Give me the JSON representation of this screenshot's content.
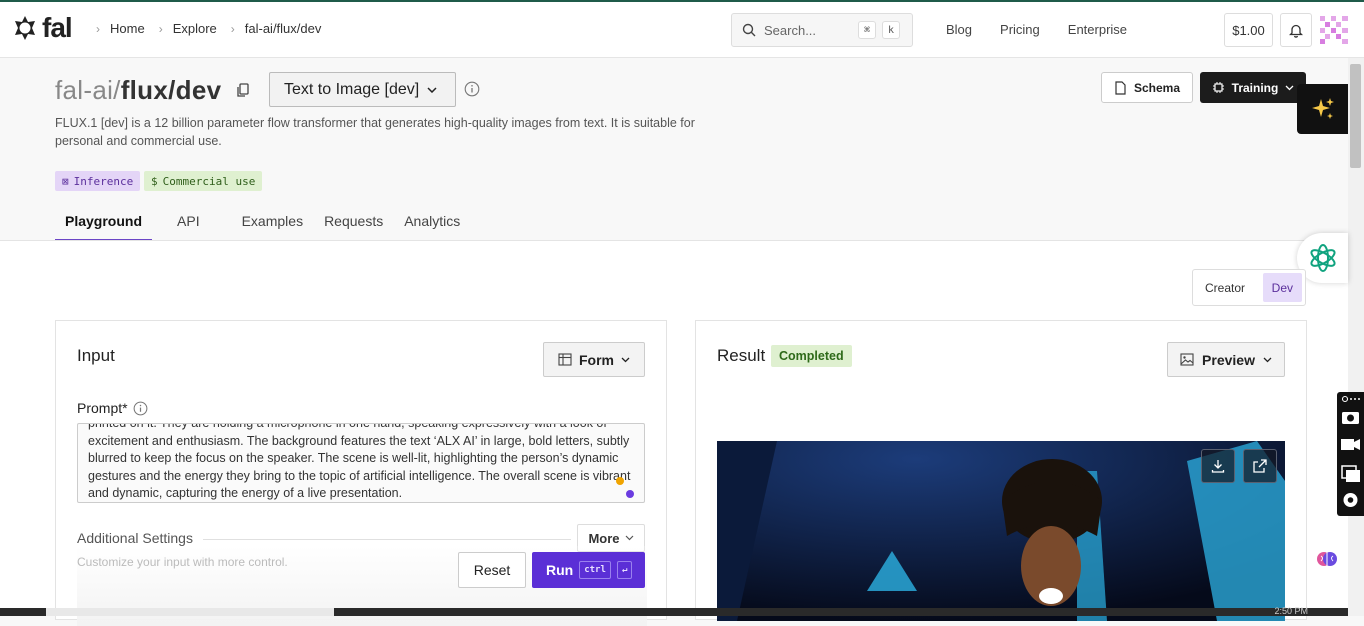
{
  "nav": {
    "logo_text": "fal",
    "breadcrumb": [
      "Home",
      "Explore",
      "fal-ai/flux/dev"
    ],
    "search_placeholder": "Search...",
    "search_keys": [
      "⌘",
      "k"
    ],
    "links": [
      "Blog",
      "Pricing",
      "Enterprise"
    ],
    "balance": "$1.00"
  },
  "header": {
    "title_prefix": "fal-ai/",
    "title_main": "flux/dev",
    "model_type": "Text to Image [dev]",
    "description": "FLUX.1 [dev] is a 12 billion parameter flow transformer that generates high-quality images from text. It is suitable for personal and commercial use.",
    "badges": [
      "Inference",
      "Commercial use"
    ],
    "schema_label": "Schema",
    "training_label": "Training"
  },
  "tabs": [
    "Playground",
    "API",
    "Examples",
    "Requests",
    "Analytics"
  ],
  "active_tab": "Playground",
  "mode": {
    "options": [
      "Creator",
      "Dev"
    ],
    "selected": "Dev"
  },
  "input": {
    "title": "Input",
    "form_label": "Form",
    "prompt_label": "Prompt*",
    "prompt_text": "printed on it. They are holding a microphone in one hand, speaking expressively with a look of excitement and enthusiasm. The background features the text ‘ALX AI’ in large, bold letters, subtly blurred to keep the focus on the speaker. The scene is well-lit, highlighting the person’s dynamic gestures and the energy they bring to the topic of artificial intelligence. The overall scene is vibrant and dynamic, capturing the energy of a live presentation.",
    "additional_settings": "Additional Settings",
    "more_label": "More",
    "additional_sub": "Customize your input with more control.",
    "reset_label": "Reset",
    "run_label": "Run",
    "run_kbd": [
      "ctrl",
      "↵"
    ]
  },
  "result": {
    "title": "Result",
    "status": "Completed",
    "preview_label": "Preview"
  },
  "taskbar": {
    "time": "2:50 PM"
  },
  "colors": {
    "accent": "#5b2fd6",
    "tab_underline": "#6b45c6",
    "status_bg": "#dff0d0",
    "inference_bg": "#e4d5f7"
  }
}
